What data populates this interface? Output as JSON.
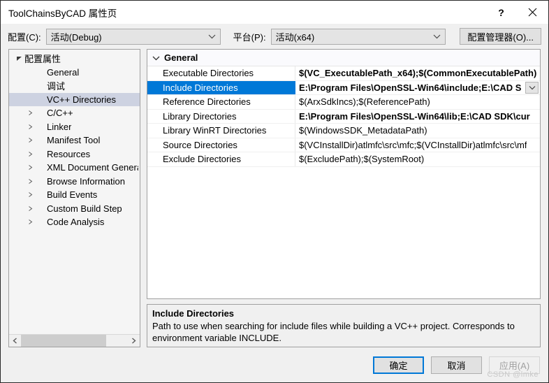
{
  "window": {
    "title": "ToolChainsByCAD 属性页",
    "help_icon": "question-mark-icon",
    "close_icon": "close-icon"
  },
  "config_bar": {
    "configuration_label": "配置(C):",
    "configuration_value": "活动(Debug)",
    "platform_label": "平台(P):",
    "platform_value": "活动(x64)",
    "config_manager_button": "配置管理器(O)..."
  },
  "tree": {
    "items": [
      {
        "label": "配置属性",
        "level": 0,
        "arrow": "expanded",
        "selected": false
      },
      {
        "label": "General",
        "level": 1,
        "arrow": "none",
        "selected": false
      },
      {
        "label": "调试",
        "level": 1,
        "arrow": "none",
        "selected": false
      },
      {
        "label": "VC++ Directories",
        "level": 1,
        "arrow": "none",
        "selected": true
      },
      {
        "label": "C/C++",
        "level": 1,
        "arrow": "collapsed",
        "selected": false
      },
      {
        "label": "Linker",
        "level": 1,
        "arrow": "collapsed",
        "selected": false
      },
      {
        "label": "Manifest Tool",
        "level": 1,
        "arrow": "collapsed",
        "selected": false
      },
      {
        "label": "Resources",
        "level": 1,
        "arrow": "collapsed",
        "selected": false
      },
      {
        "label": "XML Document Generat",
        "level": 1,
        "arrow": "collapsed",
        "selected": false
      },
      {
        "label": "Browse Information",
        "level": 1,
        "arrow": "collapsed",
        "selected": false
      },
      {
        "label": "Build Events",
        "level": 1,
        "arrow": "collapsed",
        "selected": false
      },
      {
        "label": "Custom Build Step",
        "level": 1,
        "arrow": "collapsed",
        "selected": false
      },
      {
        "label": "Code Analysis",
        "level": 1,
        "arrow": "collapsed",
        "selected": false
      }
    ],
    "scrollbar": {
      "left_arrow_icon": "chevron-left-icon",
      "right_arrow_icon": "chevron-right-icon"
    }
  },
  "grid": {
    "group_header": "General",
    "group_arrow": "chevron-down-icon",
    "rows": [
      {
        "name": "Executable Directories",
        "value": "$(VC_ExecutablePath_x64);$(CommonExecutablePath)",
        "modified": true,
        "selected": false
      },
      {
        "name": "Include Directories",
        "value": "E:\\Program Files\\OpenSSL-Win64\\include;E:\\CAD S",
        "modified": true,
        "selected": true,
        "dropdown_icon": "chevron-down-icon"
      },
      {
        "name": "Reference Directories",
        "value": "$(ArxSdkIncs);$(ReferencePath)",
        "modified": false,
        "selected": false
      },
      {
        "name": "Library Directories",
        "value": "E:\\Program Files\\OpenSSL-Win64\\lib;E:\\CAD SDK\\cur",
        "modified": true,
        "selected": false
      },
      {
        "name": "Library WinRT Directories",
        "value": "$(WindowsSDK_MetadataPath)",
        "modified": false,
        "selected": false
      },
      {
        "name": "Source Directories",
        "value": "$(VCInstallDir)atlmfc\\src\\mfc;$(VCInstallDir)atlmfc\\src\\mf",
        "modified": false,
        "selected": false
      },
      {
        "name": "Exclude Directories",
        "value": "$(ExcludePath);$(SystemRoot)",
        "modified": false,
        "selected": false
      }
    ]
  },
  "description": {
    "title": "Include Directories",
    "text": "Path to use when searching for include files while building a VC++ project.  Corresponds to environment variable INCLUDE."
  },
  "footer": {
    "ok_label": "确定",
    "cancel_label": "取消",
    "apply_label": "应用(A)"
  },
  "watermark": "CSDN @lmke",
  "colors": {
    "selection_blue": "#0078d7",
    "tree_selection": "#cdd2e1",
    "dialog_bg": "#f0f0f0"
  }
}
